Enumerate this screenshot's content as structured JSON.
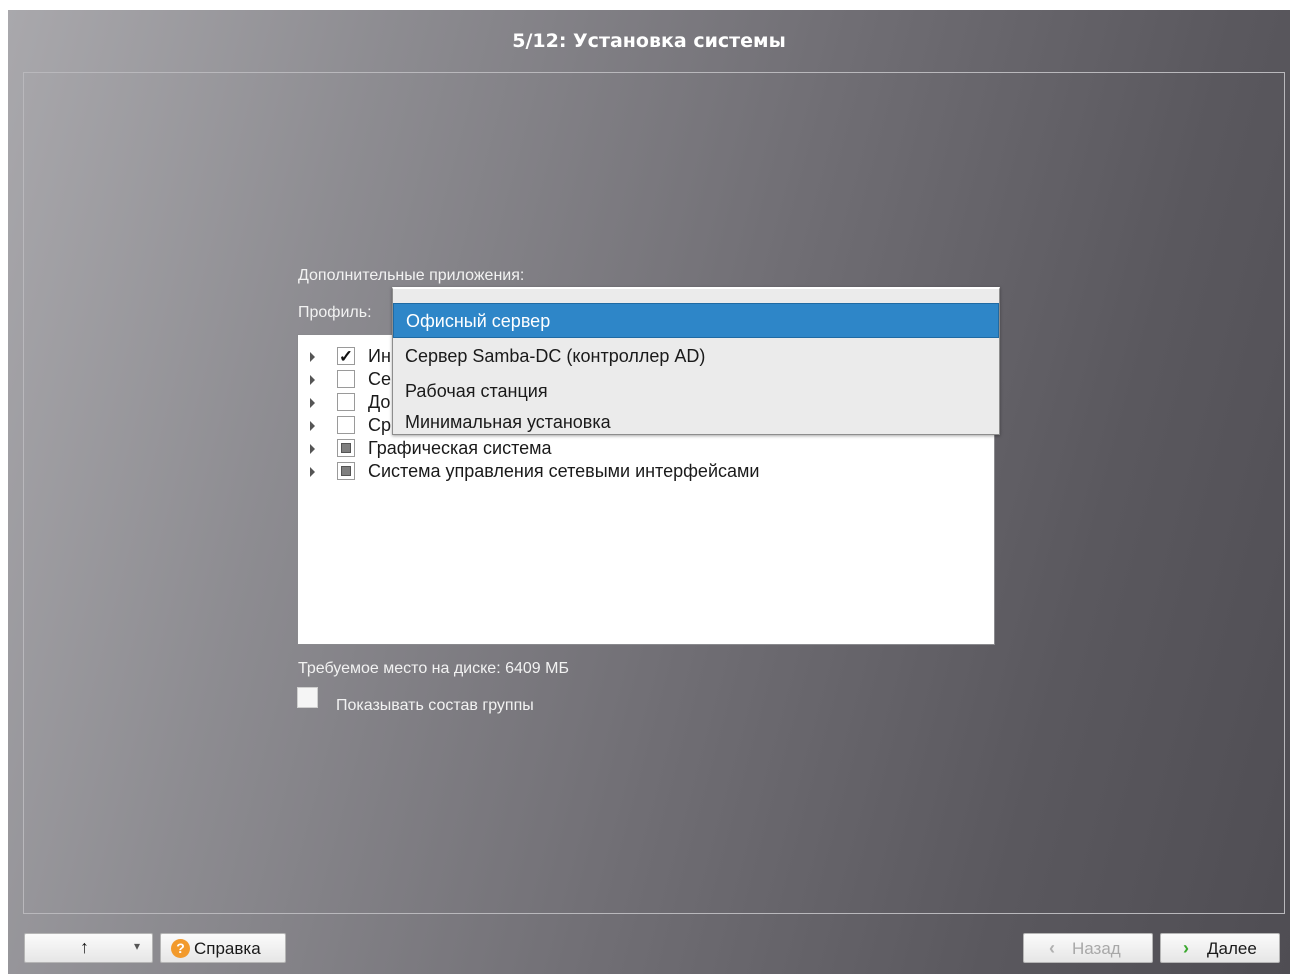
{
  "window": {
    "title": "5/12: Установка системы"
  },
  "section": {
    "heading": "Дополнительные приложения:",
    "profile_label": "Профиль:"
  },
  "profile_dropdown": {
    "selected_index": 0,
    "options": [
      "Офисный сервер",
      "Сервер Samba-DC (контроллер AD)",
      "Рабочая станция",
      "Минимальная установка"
    ]
  },
  "groups": [
    {
      "label": "Ин",
      "state": "checked",
      "check_glyph": "✓"
    },
    {
      "label": "Се",
      "state": "unchecked"
    },
    {
      "label": "До",
      "state": "unchecked"
    },
    {
      "label": "Ср",
      "state": "unchecked"
    },
    {
      "label": "Графическая система",
      "state": "partial"
    },
    {
      "label": "Система управления сетевыми интерфейсами",
      "state": "partial"
    }
  ],
  "disk_space": "Требуемое место на диске: 6409 МБ",
  "show_group_contents": {
    "label": "Показывать состав группы",
    "checked": false
  },
  "footer": {
    "up_glyph": "↑",
    "dropdown_glyph": "▾",
    "help_icon_glyph": "?",
    "help_label": "Справка",
    "back_glyph": "‹",
    "back_label": "Назад",
    "next_glyph": "›",
    "next_label": "Далее"
  },
  "colors": {
    "accent": "#2e86c8",
    "help_icon": "#f29a2c",
    "next_chevron": "#3aa82e"
  }
}
